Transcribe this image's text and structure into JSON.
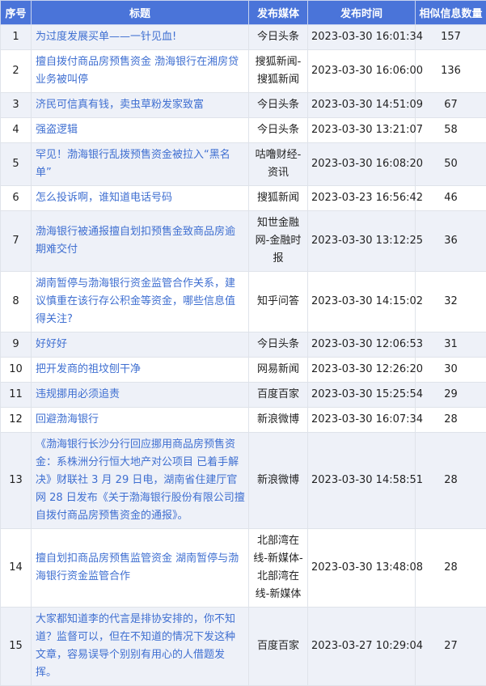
{
  "headers": {
    "idx": "序号",
    "title": "标题",
    "media": "发布媒体",
    "time": "发布时间",
    "count": "相似信息数量"
  },
  "rows": [
    {
      "idx": "1",
      "title": "为过度发展买单——一针见血!",
      "media": "今日头条",
      "time": "2023-03-30 16:01:34",
      "count": "157"
    },
    {
      "idx": "2",
      "title": "擅自拨付商品房预售资金 渤海银行在湘房贷业务被叫停",
      "media": "搜狐新闻-搜狐新闻",
      "time": "2023-03-30 16:06:00",
      "count": "136"
    },
    {
      "idx": "3",
      "title": "济民可信真有钱，卖虫草粉发家致富",
      "media": "今日头条",
      "time": "2023-03-30 14:51:09",
      "count": "67"
    },
    {
      "idx": "4",
      "title": "强盗逻辑",
      "media": "今日头条",
      "time": "2023-03-30 13:21:07",
      "count": "58"
    },
    {
      "idx": "5",
      "title": "罕见！渤海银行乱拨预售资金被拉入“黑名单”",
      "media": "咕噜财经-资讯",
      "time": "2023-03-30 16:08:20",
      "count": "50"
    },
    {
      "idx": "6",
      "title": "怎么投诉啊，谁知道电话号码",
      "media": "搜狐新闻",
      "time": "2023-03-23 16:56:42",
      "count": "46"
    },
    {
      "idx": "7",
      "title": "渤海银行被通报擅自划扣预售金致商品房逾期难交付",
      "media": "知世金融网-金融时报",
      "time": "2023-03-30 13:12:25",
      "count": "36"
    },
    {
      "idx": "8",
      "title": "湖南暂停与渤海银行资金监管合作关系，建议慎重在该行存公积金等资金，哪些信息值得关注?",
      "media": "知乎问答",
      "time": "2023-03-30 14:15:02",
      "count": "32"
    },
    {
      "idx": "9",
      "title": "好好好",
      "media": "今日头条",
      "time": "2023-03-30 12:06:53",
      "count": "31"
    },
    {
      "idx": "10",
      "title": "把开发商的祖坟刨干净",
      "media": "网易新闻",
      "time": "2023-03-30 12:26:20",
      "count": "30"
    },
    {
      "idx": "11",
      "title": "违规挪用必须追责",
      "media": "百度百家",
      "time": "2023-03-30 15:25:54",
      "count": "29"
    },
    {
      "idx": "12",
      "title": "回避渤海银行",
      "media": "新浪微博",
      "time": "2023-03-30 16:07:34",
      "count": "28"
    },
    {
      "idx": "13",
      "title": "《渤海银行长沙分行回应挪用商品房预售资金：系株洲分行恒大地产对公项目 已着手解决》财联社 3 月 29 日电，湖南省住建厅官网 28 日发布《关于渤海银行股份有限公司擅自拨付商品房预售资金的通报》。",
      "media": "新浪微博",
      "time": "2023-03-30 14:58:51",
      "count": "28"
    },
    {
      "idx": "14",
      "title": "擅自划扣商品房预售监管资金 湖南暂停与渤海银行资金监管合作",
      "media": "北部湾在线-新媒体-北部湾在线-新媒体",
      "time": "2023-03-30 13:48:08",
      "count": "28"
    },
    {
      "idx": "15",
      "title": "大家都知道李的代言是排协安排的，你不知道？监督可以，但在不知道的情况下发这种文章，容易误导个别别有用心的人借题发挥。",
      "media": "百度百家",
      "time": "2023-03-27 10:29:04",
      "count": "27"
    }
  ]
}
